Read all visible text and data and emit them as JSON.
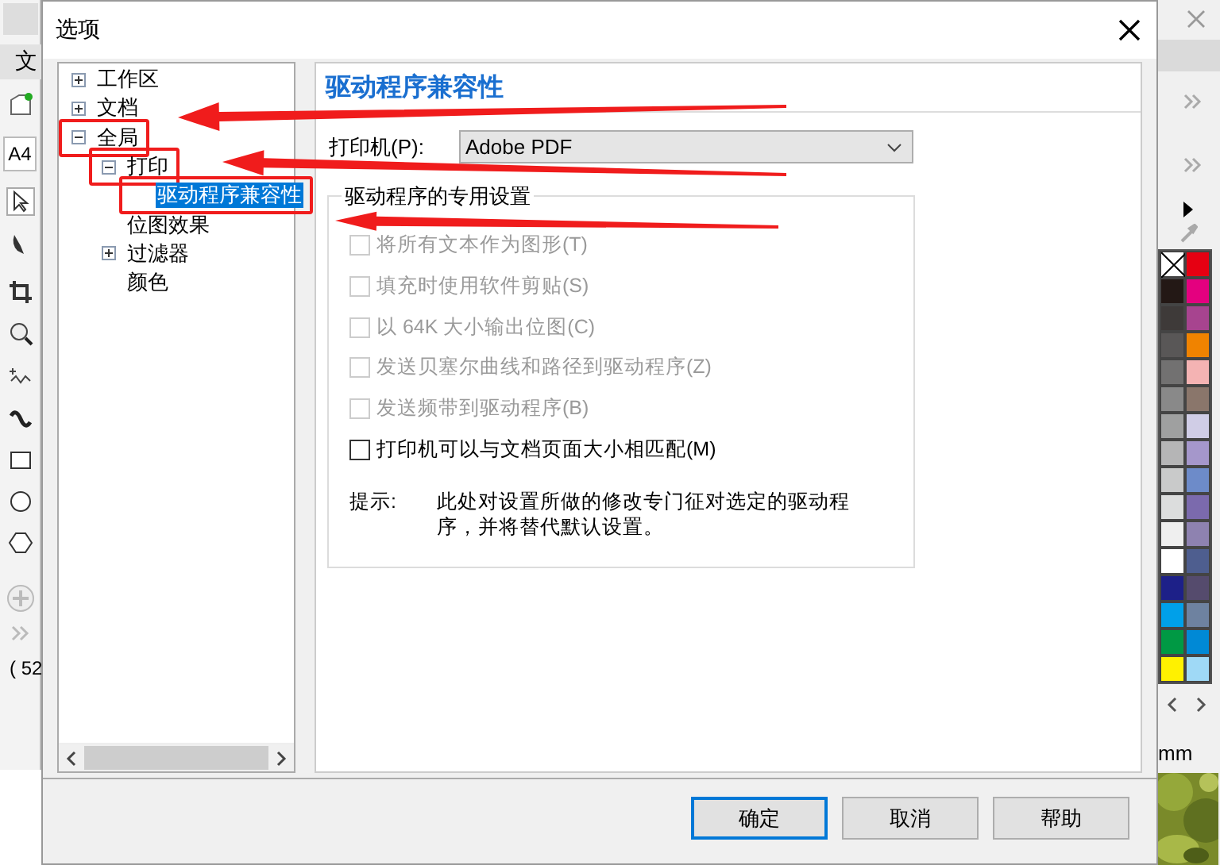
{
  "background_app": {
    "menu_text": "文",
    "page_size": "A4",
    "position": "( 52",
    "unit": "mm",
    "palette": [
      {
        "kind": "none"
      },
      {
        "kind": "swatch",
        "color": "#e60012"
      },
      {
        "kind": "swatch",
        "color": "#231815"
      },
      {
        "kind": "swatch",
        "color": "#e4007f"
      },
      {
        "kind": "swatch",
        "color": "#3e3a39"
      },
      {
        "kind": "swatch",
        "color": "#a7448f"
      },
      {
        "kind": "swatch",
        "color": "#595757"
      },
      {
        "kind": "swatch",
        "color": "#f08300"
      },
      {
        "kind": "swatch",
        "color": "#727171"
      },
      {
        "kind": "swatch",
        "color": "#f4b3b3"
      },
      {
        "kind": "swatch",
        "color": "#898989"
      },
      {
        "kind": "swatch",
        "color": "#8a766b"
      },
      {
        "kind": "swatch",
        "color": "#9fa0a0"
      },
      {
        "kind": "swatch",
        "color": "#d0cde6"
      },
      {
        "kind": "swatch",
        "color": "#b5b5b6"
      },
      {
        "kind": "swatch",
        "color": "#a597cb"
      },
      {
        "kind": "swatch",
        "color": "#c9caca"
      },
      {
        "kind": "swatch",
        "color": "#6d8bc9"
      },
      {
        "kind": "swatch",
        "color": "#dcdddd"
      },
      {
        "kind": "swatch",
        "color": "#7b6aad"
      },
      {
        "kind": "swatch",
        "color": "#efefef"
      },
      {
        "kind": "swatch",
        "color": "#8e82b0"
      },
      {
        "kind": "swatch",
        "color": "#ffffff"
      },
      {
        "kind": "swatch",
        "color": "#4e5e8f"
      },
      {
        "kind": "swatch",
        "color": "#1d2088"
      },
      {
        "kind": "swatch",
        "color": "#554b6d"
      },
      {
        "kind": "swatch",
        "color": "#00a0e9"
      },
      {
        "kind": "swatch",
        "color": "#6e82a0"
      },
      {
        "kind": "swatch",
        "color": "#009944"
      },
      {
        "kind": "swatch",
        "color": "#0089d6"
      },
      {
        "kind": "swatch",
        "color": "#fff100"
      },
      {
        "kind": "swatch",
        "color": "#9fd9f6"
      }
    ]
  },
  "dialog": {
    "title": "选项"
  },
  "tree": [
    {
      "label": "工作区",
      "expanded": false,
      "selected": false,
      "highlighted": false
    },
    {
      "label": "文档",
      "expanded": false,
      "selected": false,
      "highlighted": false
    },
    {
      "label": "全局",
      "expanded": true,
      "selected": false,
      "highlighted": true,
      "children": [
        {
          "label": "打印",
          "expanded": true,
          "selected": false,
          "highlighted": true,
          "children": [
            {
              "label": "驱动程序兼容性",
              "selected": true,
              "highlighted": true
            }
          ]
        },
        {
          "label": "位图效果",
          "selected": false,
          "highlighted": false
        },
        {
          "label": "过滤器",
          "expanded": false,
          "selected": false,
          "highlighted": false
        },
        {
          "label": "颜色",
          "selected": false,
          "highlighted": false
        }
      ]
    }
  ],
  "page": {
    "heading": "驱动程序兼容性",
    "printer": {
      "label": "打印机(P):",
      "value": "Adobe PDF"
    },
    "group_title": "驱动程序的专用设置",
    "options": [
      {
        "label": "将所有文本作为图形(T)",
        "checked": false,
        "disabled": true
      },
      {
        "label": "填充时使用软件剪贴(S)",
        "checked": false,
        "disabled": true
      },
      {
        "label": "以 64K 大小输出位图(C)",
        "checked": false,
        "disabled": true
      },
      {
        "label": "发送贝塞尔曲线和路径到驱动程序(Z)",
        "checked": false,
        "disabled": true
      },
      {
        "label": "发送频带到驱动程序(B)",
        "checked": false,
        "disabled": true
      },
      {
        "label": "打印机可以与文档页面大小相匹配(M)",
        "checked": false,
        "disabled": false
      }
    ],
    "hint_label": "提示:",
    "hint_text": "此处对设置所做的修改专门征对选定的驱动程序，并将替代默认设置。"
  },
  "buttons": [
    {
      "label": "确定",
      "default": true
    },
    {
      "label": "取消",
      "default": false
    },
    {
      "label": "帮助",
      "default": false
    }
  ]
}
